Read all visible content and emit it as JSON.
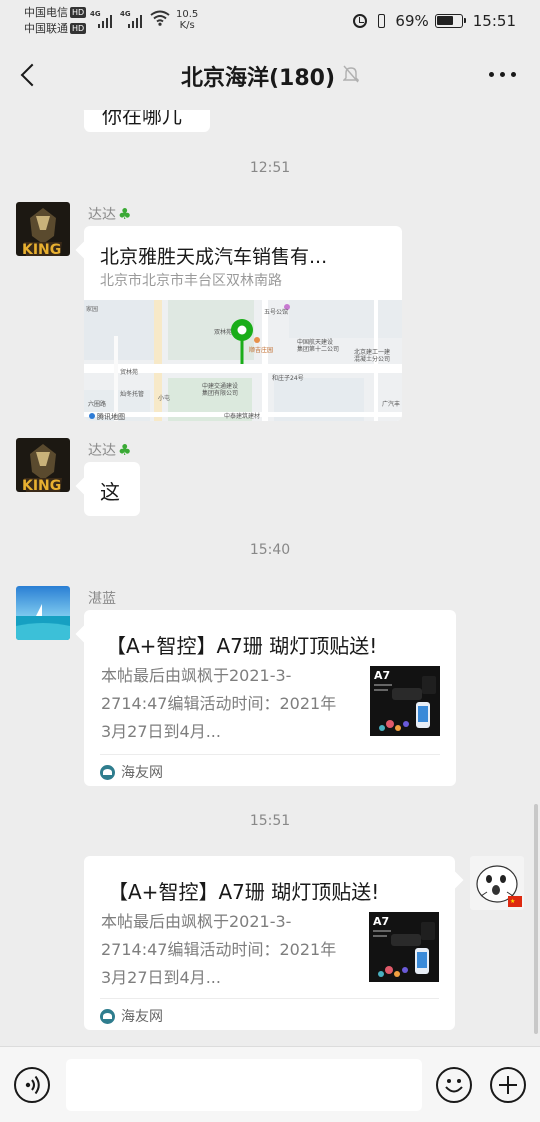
{
  "status": {
    "carrier1": "中国电信",
    "carrier2": "中国联通",
    "hd_label": "HD",
    "network": "4G",
    "speed_value": "10.5",
    "speed_unit": "K/s",
    "battery": "69%",
    "battery_level": 0.69,
    "clock": "15:51"
  },
  "header": {
    "title": "北京海洋(180)"
  },
  "messages": {
    "partial_text": "你在哪儿",
    "time1": "12:51",
    "msg1": {
      "sender": "达达",
      "location_title": "北京雅胜天成汽车销售有...",
      "location_address": "北京市北京市丰台区双林南路"
    },
    "map_labels": {
      "l1": "家园",
      "l2": "双林苑",
      "l3": "五号公馆",
      "l4": "顺吉庄园",
      "l5": "中国航天建设",
      "l5b": "集团第十二公司",
      "l6": "北京建工一建",
      "l6b": "混凝土分公司",
      "l7": "和庄子24号",
      "l8": "中建交通建设",
      "l8b": "集团有限公司",
      "l9": "灿冬托管",
      "l10": "中泰建筑建材",
      "l11": "广汽丰",
      "l12": "腾讯地图",
      "l13": "贸林苑",
      "l14": "六圈路",
      "l15": "小屯"
    },
    "msg2": {
      "sender": "达达",
      "text": "这"
    },
    "time2": "15:40",
    "msg3": {
      "sender": "湛蓝",
      "card_title": "【A+智控】A7珊 瑚灯顶贴送!",
      "card_desc": "本帖最后由飒枫于2021-3-2714:47编辑活动时间：2021年3月27日到4月...",
      "card_source": "海友网",
      "thumb_label": "A7"
    },
    "time3": "15:51",
    "msg4": {
      "card_title": "【A+智控】A7珊 瑚灯顶贴送!",
      "card_desc": "本帖最后由飒枫于2021-3-2714:47编辑活动时间：2021年3月27日到4月...",
      "card_source": "海友网",
      "thumb_label": "A7"
    }
  },
  "composer": {
    "input_value": ""
  },
  "colors": {
    "chat_bg": "#ededed",
    "bubble_bg": "#ffffff",
    "map_pin": "#1aad19",
    "bottom_bar_bg": "#f6f6f6"
  }
}
